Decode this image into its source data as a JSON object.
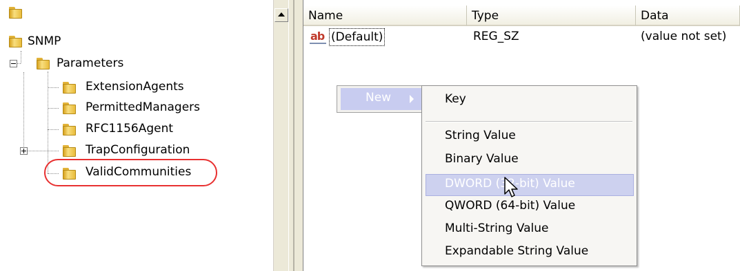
{
  "tree": {
    "items": [
      {
        "label": "",
        "kind": "folder"
      },
      {
        "label": "SNMP",
        "kind": "folder"
      },
      {
        "label": "Parameters",
        "kind": "folder",
        "expander": "minus"
      },
      {
        "label": "ExtensionAgents",
        "kind": "folder"
      },
      {
        "label": "PermittedManagers",
        "kind": "folder"
      },
      {
        "label": "RFC1156Agent",
        "kind": "folder"
      },
      {
        "label": "TrapConfiguration",
        "kind": "folder",
        "expander": "plus"
      },
      {
        "label": "ValidCommunities",
        "kind": "folder",
        "highlighted": true
      }
    ],
    "highlight_color": "#e83030"
  },
  "list": {
    "columns": [
      "Name",
      "Type",
      "Data"
    ],
    "rows": [
      {
        "icon": "string-value-icon",
        "icon_text": "ab",
        "name": "(Default)",
        "type": "REG_SZ",
        "data": "(value not set)"
      }
    ]
  },
  "context_menu": {
    "new_label": "New",
    "submenu": {
      "key": "Key",
      "string_value": "String Value",
      "binary_value": "Binary Value",
      "dword_value": "DWORD (32-bit) Value",
      "qword_value": "QWORD (64-bit) Value",
      "multi_string_value": "Multi-String Value",
      "expandable_string_value": "Expandable String Value"
    },
    "hovered_item": "dword_value"
  },
  "colors": {
    "menu_highlight": "#cdd1ef",
    "folder": "#e9bc3c",
    "ab_icon": "#c03a2b"
  }
}
